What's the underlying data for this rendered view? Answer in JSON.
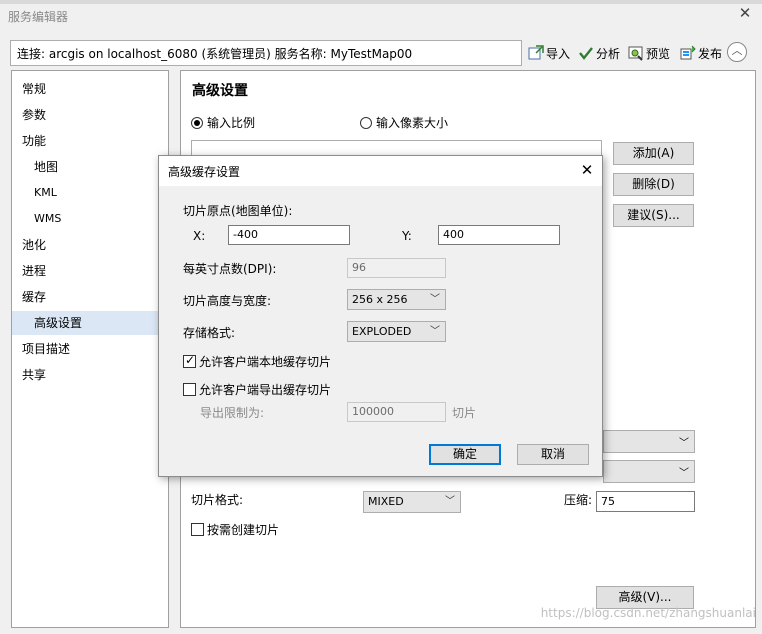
{
  "window": {
    "title": "服务编辑器",
    "close_glyph": "✕"
  },
  "toolbar": {
    "connection_text": "连接: arcgis on localhost_6080 (系统管理员)   服务名称: MyTestMap00",
    "import_label": "导入",
    "analyze_label": "分析",
    "preview_label": "预览",
    "publish_label": "发布",
    "collapse_glyph": "︿"
  },
  "sidebar": {
    "items": [
      {
        "label": "常规"
      },
      {
        "label": "参数"
      },
      {
        "label": "功能"
      },
      {
        "label": "地图"
      },
      {
        "label": "KML"
      },
      {
        "label": "WMS"
      },
      {
        "label": "池化"
      },
      {
        "label": "进程"
      },
      {
        "label": "缓存"
      },
      {
        "label": "高级设置"
      },
      {
        "label": "项目描述"
      },
      {
        "label": "共享"
      }
    ]
  },
  "main": {
    "heading": "高级设置",
    "radio_scale": "输入比例",
    "radio_pixel": "输入像素大小",
    "add_label": "添加(A)",
    "delete_label": "删除(D)",
    "suggest_label": "建议(S)...",
    "tile_format_label": "切片格式:",
    "tile_format_value": "MIXED",
    "compression_label": "压缩:",
    "compression_value": "75",
    "create_on_demand_label": "按需创建切片",
    "advanced_label": "高级(V)..."
  },
  "dialog": {
    "title": "高级缓存设置",
    "close_glyph": "✕",
    "origin_label": "切片原点(地图单位):",
    "x_label": "X:",
    "x_value": "-400",
    "y_label": "Y:",
    "y_value": "400",
    "dpi_label": "每英寸点数(DPI):",
    "dpi_value": "96",
    "tile_size_label": "切片高度与宽度:",
    "tile_size_value": "256 x 256",
    "storage_label": "存储格式:",
    "storage_value": "EXPLODED",
    "allow_client_cache_label": "允许客户端本地缓存切片",
    "allow_client_export_label": "允许客户端导出缓存切片",
    "export_limit_label": "导出限制为:",
    "export_limit_value": "100000",
    "export_limit_unit": "切片",
    "ok_label": "确定",
    "cancel_label": "取消"
  },
  "watermark": "https://blog.csdn.net/zhangshuanlai"
}
